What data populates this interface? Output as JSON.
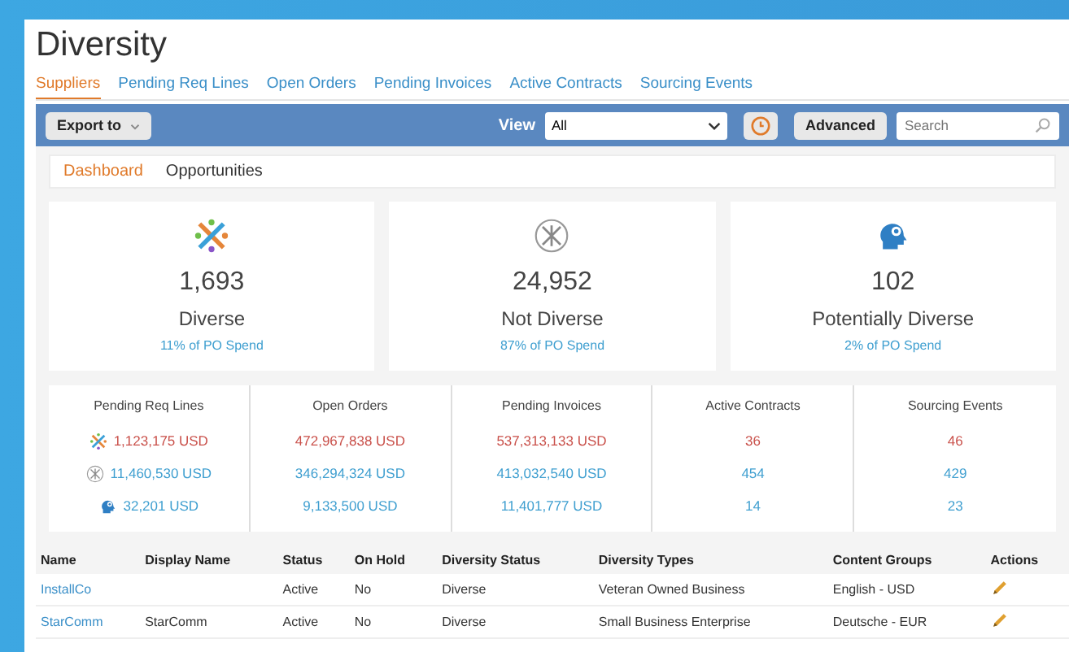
{
  "title": "Diversity",
  "tabs": [
    {
      "label": "Suppliers",
      "selected": true
    },
    {
      "label": "Pending Req Lines",
      "selected": false
    },
    {
      "label": "Open Orders",
      "selected": false
    },
    {
      "label": "Pending Invoices",
      "selected": false
    },
    {
      "label": "Active Contracts",
      "selected": false
    },
    {
      "label": "Sourcing Events",
      "selected": false
    }
  ],
  "toolbar": {
    "export": "Export to",
    "view_label": "View",
    "view_value": "All",
    "advanced": "Advanced",
    "search": {
      "placeholder": "Search"
    }
  },
  "subtabs": [
    {
      "label": "Dashboard",
      "selected": true
    },
    {
      "label": "Opportunities",
      "selected": false
    }
  ],
  "cards": [
    {
      "kind": "diverse",
      "count": "1,693",
      "label": "Diverse",
      "spend": "11% of PO Spend"
    },
    {
      "kind": "not_diverse",
      "count": "24,952",
      "label": "Not Diverse",
      "spend": "87% of PO Spend"
    },
    {
      "kind": "potential",
      "count": "102",
      "label": "Potentially Diverse",
      "spend": "2% of PO Spend"
    }
  ],
  "metrics": {
    "columns": [
      "Pending Req Lines",
      "Open Orders",
      "Pending Invoices",
      "Active Contracts",
      "Sourcing Events"
    ],
    "rows": [
      {
        "kind": "diverse",
        "color": "#c9504a",
        "values": [
          "1,123,175 USD",
          "472,967,838 USD",
          "537,313,133 USD",
          "36",
          "46"
        ]
      },
      {
        "kind": "not_diverse",
        "color": "#3f9fd0",
        "values": [
          "11,460,530 USD",
          "346,294,324 USD",
          "413,032,540 USD",
          "454",
          "429"
        ]
      },
      {
        "kind": "potential",
        "color": "#3f9fd0",
        "values": [
          "32,201 USD",
          "9,133,500 USD",
          "11,401,777 USD",
          "14",
          "23"
        ]
      }
    ]
  },
  "table": {
    "columns": [
      "Name",
      "Display Name",
      "Status",
      "On Hold",
      "Diversity Status",
      "Diversity Types",
      "Content Groups",
      "Actions"
    ],
    "rows": [
      {
        "name": "InstallCo",
        "display_name": "",
        "status": "Active",
        "on_hold": "No",
        "diversity_status": "Diverse",
        "diversity_types": "Veteran Owned Business",
        "content_groups": "English - USD"
      },
      {
        "name": "StarComm",
        "display_name": "StarComm",
        "status": "Active",
        "on_hold": "No",
        "diversity_status": "Diverse",
        "diversity_types": "Small Business Enterprise",
        "content_groups": "Deutsche - EUR"
      }
    ]
  }
}
